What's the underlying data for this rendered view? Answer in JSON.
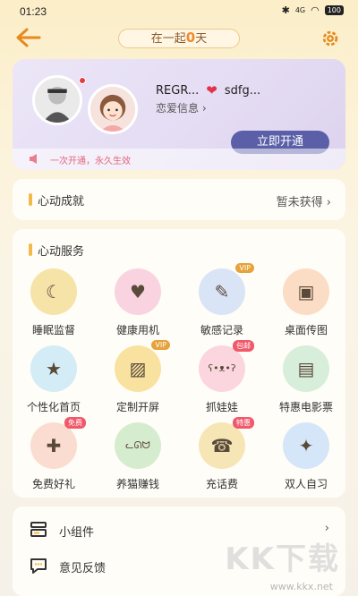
{
  "status_bar": {
    "time": "01:23",
    "signal": "4G",
    "battery": "100"
  },
  "header": {
    "title_prefix": "在一起",
    "title_days": "0",
    "title_suffix": "天"
  },
  "profile": {
    "user_a_name": "REGR...",
    "user_b_name": "sdfg...",
    "love_info_link": "恋爱信息 ›",
    "open_button": "立即开通",
    "promo_text": "一次开通，永久生效",
    "accent_color": "#5a5fa8"
  },
  "achievement": {
    "title": "心动成就",
    "status": "暂未获得 ›"
  },
  "services": {
    "title": "心动服务",
    "items": [
      {
        "label": "睡眠监督",
        "icon": "sleep-icon",
        "color": "#f6e3a8",
        "badge": ""
      },
      {
        "label": "健康用机",
        "icon": "health-icon",
        "color": "#f9d4e0",
        "badge": ""
      },
      {
        "label": "敏感记录",
        "icon": "record-icon",
        "color": "#d9e4f7",
        "badge": "VIP"
      },
      {
        "label": "桌面传图",
        "icon": "photo-icon",
        "color": "#fbdcc5",
        "badge": ""
      },
      {
        "label": "个性化首页",
        "icon": "star-icon",
        "color": "#d3ecf5",
        "badge": ""
      },
      {
        "label": "定制开屏",
        "icon": "image-icon",
        "color": "#f9e2a0",
        "badge": "VIP"
      },
      {
        "label": "抓娃娃",
        "icon": "bear-icon",
        "color": "#fbd6de",
        "badge": "包邮"
      },
      {
        "label": "特惠电影票",
        "icon": "ticket-icon",
        "color": "#d7eedb",
        "badge": ""
      },
      {
        "label": "免费好礼",
        "icon": "gift-icon",
        "color": "#fbdcd0",
        "badge": "免费"
      },
      {
        "label": "养猫赚钱",
        "icon": "cat-icon",
        "color": "#d6eccf",
        "badge": ""
      },
      {
        "label": "充话费",
        "icon": "phone-icon",
        "color": "#f7e6b5",
        "badge": "特惠"
      },
      {
        "label": "双人自习",
        "icon": "study-icon",
        "color": "#d4e6f8",
        "badge": ""
      }
    ]
  },
  "tools": [
    {
      "label": "小组件",
      "icon": "widget-icon",
      "chevron": "›"
    },
    {
      "label": "意见反馈",
      "icon": "feedback-icon",
      "chevron": ""
    }
  ],
  "watermark": {
    "text": "KK下载",
    "url": "www.kkx.net"
  }
}
